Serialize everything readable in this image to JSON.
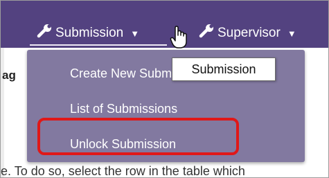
{
  "navbar": {
    "items": [
      {
        "label": "Submission",
        "icon": "wrench-icon",
        "caret": "▼"
      },
      {
        "label": "Supervisor",
        "icon": "wrench-icon",
        "caret": "▼"
      }
    ]
  },
  "background": {
    "left_heading": "ag",
    "bottom_text": "e. To do so, select the row in the table which"
  },
  "dropdown": {
    "items": [
      "Create New Submission",
      "List of Submissions",
      "Unlock Submission"
    ],
    "highlighted": "Unlock Submission"
  },
  "tooltip": {
    "text": "Submission"
  },
  "colors": {
    "navbar": "#534280",
    "dropdown": "#8279a0",
    "highlight_border": "#e01818"
  }
}
